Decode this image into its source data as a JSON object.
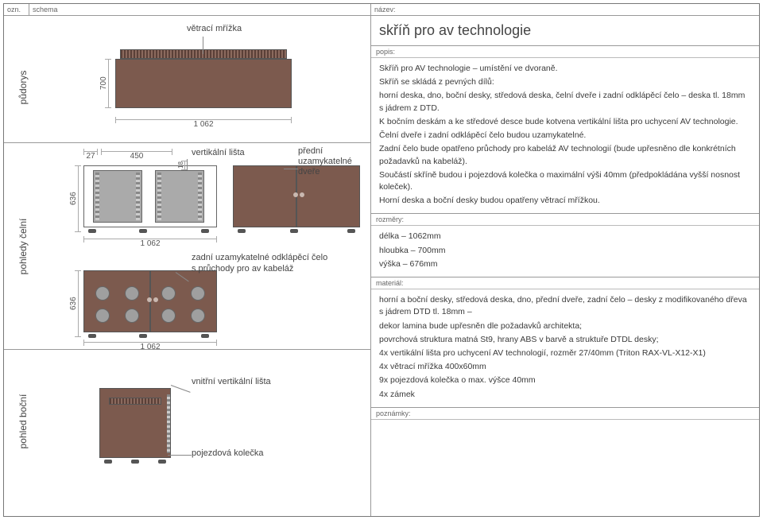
{
  "header": {
    "ozn": "ozn.",
    "schema": "schema",
    "nazev": "název:"
  },
  "left": {
    "top": {
      "section_label": "půdorys",
      "callout_top": "větrací mřížka",
      "dim_width": "1 062",
      "dim_depth": "700"
    },
    "mid": {
      "section_label": "pohledy čelní",
      "dim_27": "27",
      "dim_450": "450",
      "dim_18": "18",
      "dim_636a": "636",
      "dim_636b": "636",
      "dim_1062a": "1 062",
      "dim_1062b": "1 062",
      "callout_vert_lista": "vertikální lišta",
      "callout_front_door_l1": "přední",
      "callout_front_door_l2": "uzamykatelné",
      "callout_front_door_l3": "dveře",
      "callout_back_panel_l1": "zadní uzamykatelné odklápěcí čelo",
      "callout_back_panel_l2": "s průchody pro av kabeláž"
    },
    "bot": {
      "section_label": "pohled boční",
      "callout_inner_rail": "vnitřní vertikální lišta",
      "callout_caster": "pojezdová kolečka"
    }
  },
  "right": {
    "title": "skříň pro av technologie",
    "popis_label": "popis:",
    "popis_lines": [
      "Skříň pro AV technologie – umístění ve dvoraně.",
      "Skříň se skládá z pevných dílů:",
      "horní deska, dno, boční desky, středová deska, čelní dveře i zadní odklápěcí čelo – deska tl. 18mm s jádrem z DTD.",
      "K bočním deskám a ke středové desce bude kotvena vertikální lišta pro uchycení AV technologie.",
      "Čelní dveře i zadní odklápěcí čelo budou uzamykatelné.",
      "Zadní čelo bude opatřeno průchody pro kabeláž AV technologií (bude upřesněno dle konkrétních požadavků na kabeláž).",
      "Součástí skříně budou i pojezdová kolečka o maximální výši 40mm (předpokládána vyšší nosnost koleček).",
      "Horní deska a boční desky budou opatřeny větrací mřížkou."
    ],
    "rozmery_label": "rozměry:",
    "rozmery_lines": [
      "délka – 1062mm",
      "hloubka – 700mm",
      "výška – 676mm"
    ],
    "material_label": "materiál:",
    "material_lines": [
      "horní a boční desky, středová deska, dno, přední dveře, zadní čelo – desky z modifikovaného dřeva s jádrem DTD tl. 18mm –",
      "dekor lamina bude upřesněn dle požadavků architekta;",
      "povrchová struktura matná St9, hrany ABS v barvě a struktuře DTDL desky;",
      "4x vertikální lišta pro uchycení AV technologií, rozměr 27/40mm (Triton RAX-VL-X12-X1)",
      "4x větrací mřížka 400x60mm",
      "9x pojezdová kolečka o max. výšce 40mm",
      "4x zámek"
    ],
    "poznamky_label": "poznámky:"
  }
}
